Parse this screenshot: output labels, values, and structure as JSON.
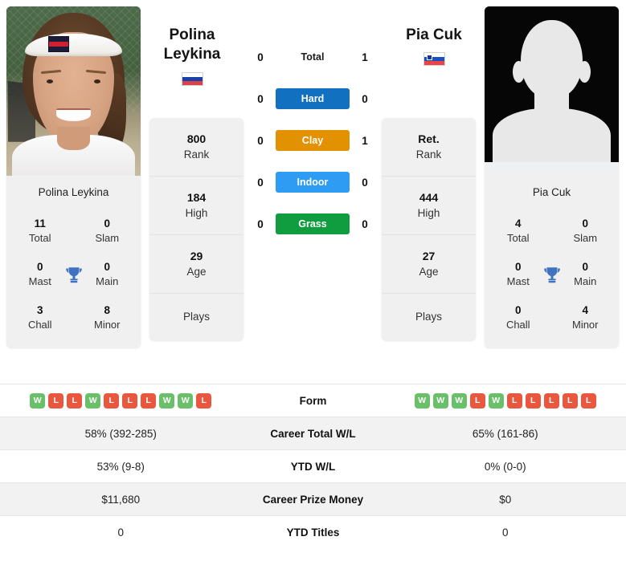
{
  "players": {
    "left": {
      "name_line1": "Polina",
      "name_line2": "Leykina",
      "full_name": "Polina Leykina",
      "flag": "russia-flag",
      "photo": "player-photo",
      "titles": {
        "total_value": "11",
        "total_label": "Total",
        "slam_value": "0",
        "slam_label": "Slam",
        "mast_value": "0",
        "mast_label": "Mast",
        "main_value": "0",
        "main_label": "Main",
        "chall_value": "3",
        "chall_label": "Chall",
        "minor_value": "8",
        "minor_label": "Minor"
      },
      "rank": {
        "value": "800",
        "label": "Rank"
      },
      "high": {
        "value": "184",
        "label": "High"
      },
      "age": {
        "value": "29",
        "label": "Age"
      },
      "plays_label": "Plays",
      "plays_value": "",
      "form": [
        "W",
        "L",
        "L",
        "W",
        "L",
        "L",
        "L",
        "W",
        "W",
        "L"
      ],
      "career_total_wl": "58% (392-285)",
      "ytd_wl": "53% (9-8)",
      "career_prize_money": "$11,680",
      "ytd_titles": "0"
    },
    "right": {
      "name_line1": "Pia Cuk",
      "name_line2": "",
      "full_name": "Pia Cuk",
      "flag": "slovenia-flag",
      "photo": "generic-avatar",
      "titles": {
        "total_value": "4",
        "total_label": "Total",
        "slam_value": "0",
        "slam_label": "Slam",
        "mast_value": "0",
        "mast_label": "Mast",
        "main_value": "0",
        "main_label": "Main",
        "chall_value": "0",
        "chall_label": "Chall",
        "minor_value": "4",
        "minor_label": "Minor"
      },
      "rank": {
        "value": "Ret.",
        "label": "Rank"
      },
      "high": {
        "value": "444",
        "label": "High"
      },
      "age": {
        "value": "27",
        "label": "Age"
      },
      "plays_label": "Plays",
      "plays_value": "",
      "form": [
        "W",
        "W",
        "W",
        "L",
        "W",
        "L",
        "L",
        "L",
        "L",
        "L"
      ],
      "career_total_wl": "65% (161-86)",
      "ytd_wl": "0% (0-0)",
      "career_prize_money": "$0",
      "ytd_titles": "0"
    }
  },
  "head_to_head": [
    {
      "surface": "Total",
      "left": "0",
      "right": "1",
      "color": ""
    },
    {
      "surface": "Hard",
      "left": "0",
      "right": "0",
      "color": "#1270c0"
    },
    {
      "surface": "Clay",
      "left": "0",
      "right": "1",
      "color": "#e29100"
    },
    {
      "surface": "Indoor",
      "left": "0",
      "right": "0",
      "color": "#2f9cf4"
    },
    {
      "surface": "Grass",
      "left": "0",
      "right": "0",
      "color": "#0f9d3f"
    }
  ],
  "table": {
    "form_label": "Form",
    "rows": [
      {
        "label": "Career Total W/L",
        "left": "58% (392-285)",
        "right": "65% (161-86)"
      },
      {
        "label": "YTD W/L",
        "left": "53% (9-8)",
        "right": "0% (0-0)"
      },
      {
        "label": "Career Prize Money",
        "left": "$11,680",
        "right": "$0"
      },
      {
        "label": "YTD Titles",
        "left": "0",
        "right": "0"
      }
    ]
  },
  "colors": {
    "win": "#6abf69",
    "loss": "#e9573f",
    "hard": "#1270c0",
    "clay": "#e29100",
    "indoor": "#2f9cf4",
    "grass": "#0f9d3f",
    "card_bg": "#f0f0f0"
  }
}
